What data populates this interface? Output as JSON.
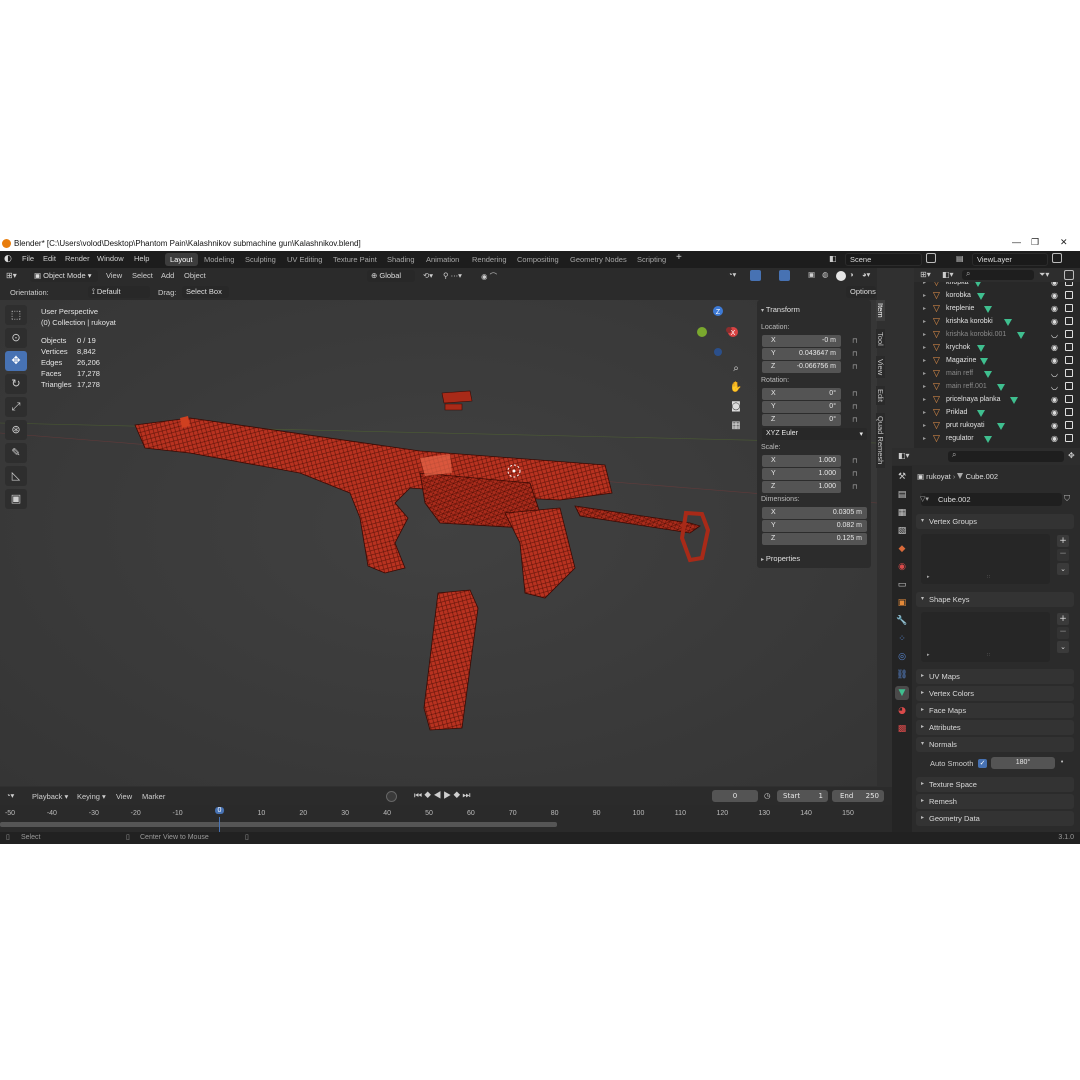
{
  "window": {
    "title": "Blender* [C:\\Users\\volod\\Desktop\\Phantom Pain\\Kalashnikov submachine gun\\Kalashnikov.blend]",
    "min": "—",
    "max": "❐",
    "close": "✕"
  },
  "menu": [
    "File",
    "Edit",
    "Render",
    "Window",
    "Help"
  ],
  "workspaces": [
    "Layout",
    "Modeling",
    "Sculpting",
    "UV Editing",
    "Texture Paint",
    "Shading",
    "Animation",
    "Rendering",
    "Compositing",
    "Geometry Nodes",
    "Scripting"
  ],
  "active_workspace": "Layout",
  "scene": "Scene",
  "view_layer": "ViewLayer",
  "viewport": {
    "mode": "Object Mode",
    "menus": [
      "View",
      "Select",
      "Add",
      "Object"
    ],
    "orientation_label": "Orientation:",
    "orientation": "Default",
    "drag_label": "Drag:",
    "drag": "Select Box",
    "transform_orientation": "Global",
    "options": "Options",
    "perspective": "User Perspective",
    "collection": "(0) Collection | rukoyat",
    "stats": [
      {
        "k": "Objects",
        "v": "0 / 19"
      },
      {
        "k": "Vertices",
        "v": "8,842"
      },
      {
        "k": "Edges",
        "v": "26,206"
      },
      {
        "k": "Faces",
        "v": "17,278"
      },
      {
        "k": "Triangles",
        "v": "17,278"
      }
    ],
    "gizmo_axes": {
      "x": "X",
      "y": "Y",
      "z": "Z"
    }
  },
  "npanel": {
    "title": "Transform",
    "location_label": "Location:",
    "location": [
      {
        "ax": "X",
        "v": "-0 m"
      },
      {
        "ax": "Y",
        "v": "0.043647 m"
      },
      {
        "ax": "Z",
        "v": "-0.066756 m"
      }
    ],
    "rotation_label": "Rotation:",
    "rotation": [
      {
        "ax": "X",
        "v": "0°"
      },
      {
        "ax": "Y",
        "v": "0°"
      },
      {
        "ax": "Z",
        "v": "0°"
      }
    ],
    "rotation_mode": "XYZ Euler",
    "scale_label": "Scale:",
    "scale": [
      {
        "ax": "X",
        "v": "1.000"
      },
      {
        "ax": "Y",
        "v": "1.000"
      },
      {
        "ax": "Z",
        "v": "1.000"
      }
    ],
    "dimensions_label": "Dimensions:",
    "dimensions": [
      {
        "ax": "X",
        "v": "0.0305 m"
      },
      {
        "ax": "Y",
        "v": "0.082 m"
      },
      {
        "ax": "Z",
        "v": "0.125 m"
      }
    ],
    "properties": "Properties",
    "tabs": [
      "Item",
      "Tool",
      "View",
      "Edit",
      "Quad Remesh"
    ]
  },
  "outliner": {
    "items": [
      {
        "name": "knopka",
        "dim": false
      },
      {
        "name": "korobka",
        "dim": false
      },
      {
        "name": "kreplenie",
        "dim": false
      },
      {
        "name": "krishka korobki",
        "dim": false
      },
      {
        "name": "krishka korobki.001",
        "dim": true
      },
      {
        "name": "krychok",
        "dim": false
      },
      {
        "name": "Magazine",
        "dim": false
      },
      {
        "name": "main reff",
        "dim": true
      },
      {
        "name": "main reff.001",
        "dim": true
      },
      {
        "name": "pricelnaya planka",
        "dim": false
      },
      {
        "name": "Priklad",
        "dim": false
      },
      {
        "name": "prut rukoyati",
        "dim": false
      },
      {
        "name": "regulator",
        "dim": false
      }
    ]
  },
  "properties": {
    "object": "rukoyat",
    "mesh": "Cube.002",
    "mesh_field": "Cube.002",
    "vertex_groups": "Vertex Groups",
    "shape_keys": "Shape Keys",
    "uv_maps": "UV Maps",
    "vertex_colors": "Vertex Colors",
    "face_maps": "Face Maps",
    "attributes": "Attributes",
    "normals": "Normals",
    "auto_smooth": "Auto Smooth",
    "auto_smooth_angle": "180°",
    "texture_space": "Texture Space",
    "remesh": "Remesh",
    "geometry_data": "Geometry Data"
  },
  "timeline": {
    "menus": [
      "Playback",
      "Keying",
      "View",
      "Marker"
    ],
    "current_frame": "0",
    "start_label": "Start",
    "start": "1",
    "end_label": "End",
    "end": "250",
    "ticks": [
      "-50",
      "-40",
      "-30",
      "-20",
      "-10",
      "0",
      "10",
      "20",
      "30",
      "40",
      "50",
      "60",
      "70",
      "80",
      "90",
      "100",
      "110",
      "120",
      "130",
      "140",
      "150"
    ]
  },
  "status": {
    "select": "Select",
    "center": "Center View to Mouse",
    "version": "3.1.0"
  },
  "colors": {
    "accent": "#4772b3",
    "mesh": "#b83220",
    "object_tri": "#3fbf8f"
  }
}
